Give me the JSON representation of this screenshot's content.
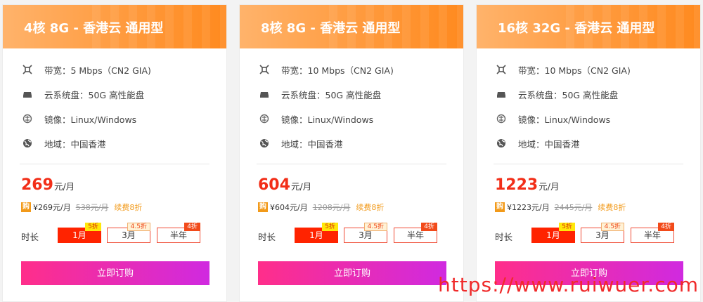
{
  "plans": [
    {
      "title": "4核 8G - 香港云 通用型",
      "specs": {
        "bandwidth": "带宽：5 Mbps（CN2 GIA)",
        "disk": "云系统盘：50G 高性能盘",
        "image": "镜像：Linux/Windows",
        "region": "地域：中国香港"
      },
      "price": "269",
      "price_unit": "元/月",
      "badge": "购",
      "sub_price": "¥269元/月",
      "orig_price": "538元/月",
      "renew": "续费8折",
      "duration_label": "时长",
      "durations": [
        {
          "label": "1月",
          "tag": "5折",
          "selected": true
        },
        {
          "label": "3月",
          "tag": "4.5折",
          "selected": false
        },
        {
          "label": "半年",
          "tag": "4折",
          "selected": false
        }
      ],
      "buy_label": "立即订购"
    },
    {
      "title": "8核 8G - 香港云 通用型",
      "specs": {
        "bandwidth": "带宽：10 Mbps（CN2 GIA)",
        "disk": "云系统盘：50G 高性能盘",
        "image": "镜像：Linux/Windows",
        "region": "地域：中国香港"
      },
      "price": "604",
      "price_unit": "元/月",
      "badge": "购",
      "sub_price": "¥604元/月",
      "orig_price": "1208元/月",
      "renew": "续费8折",
      "duration_label": "时长",
      "durations": [
        {
          "label": "1月",
          "tag": "5折",
          "selected": true
        },
        {
          "label": "3月",
          "tag": "4.5折",
          "selected": false
        },
        {
          "label": "半年",
          "tag": "4折",
          "selected": false
        }
      ],
      "buy_label": "立即订购"
    },
    {
      "title": "16核 32G - 香港云 通用型",
      "specs": {
        "bandwidth": "带宽：10 Mbps（CN2 GIA)",
        "disk": "云系统盘：50G 高性能盘",
        "image": "镜像：Linux/Windows",
        "region": "地域：中国香港"
      },
      "price": "1223",
      "price_unit": "元/月",
      "badge": "购",
      "sub_price": "¥1223元/月",
      "orig_price": "2445元/月",
      "renew": "续费8折",
      "duration_label": "时长",
      "durations": [
        {
          "label": "1月",
          "tag": "5折",
          "selected": true
        },
        {
          "label": "3月",
          "tag": "4.5折",
          "selected": false
        },
        {
          "label": "半年",
          "tag": "4折",
          "selected": false
        }
      ],
      "buy_label": "立即订购"
    }
  ],
  "icons": {
    "bandwidth": "bandwidth-icon",
    "disk": "disk-icon",
    "image": "image-icon",
    "region": "globe-icon"
  },
  "watermark": "https://www.ruiwuer.com",
  "colors": {
    "header_orange": "#ff9a3d",
    "price_red": "#f22e18",
    "accent_orange": "#f29a1a",
    "buy_gradient_start": "#ff2e8a",
    "buy_gradient_end": "#d02ae0",
    "watermark_red": "#f02a2a"
  }
}
